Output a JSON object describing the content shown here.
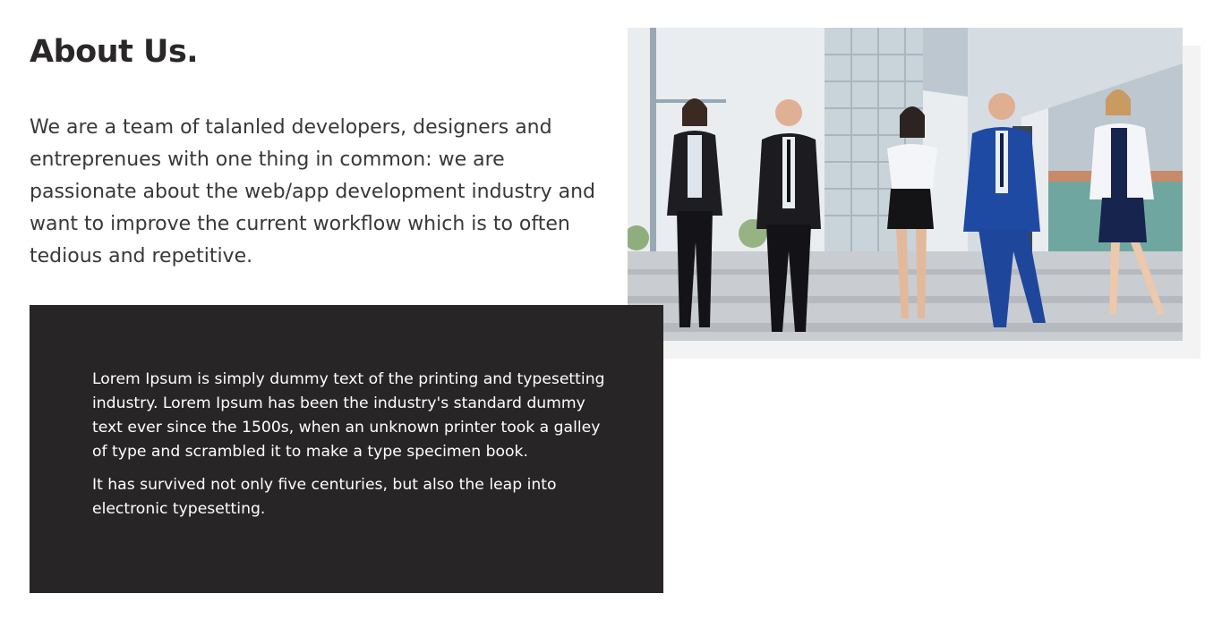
{
  "about": {
    "title": "About Us.",
    "intro": "We are a team of talanled developers, designers and entreprenues with one thing in common: we are passionate about the web/app development industry and want to improve the current workflow which is to often tedious and repetitive."
  },
  "image": {
    "description_icon": "team-photo"
  },
  "dark_panel": {
    "paragraph_1": "Lorem Ipsum is simply dummy text of the printing and typesetting industry. Lorem Ipsum has been the industry's standard dummy text ever since the 1500s, when an unknown printer took a galley of type and scrambled it to make a type specimen book.",
    "paragraph_2": "It has survived not only five centuries, but also the leap into electronic typesetting."
  },
  "colors": {
    "dark_panel_bg": "#272526",
    "photo_shadow": "#f3f3f3",
    "heading": "#2a2727"
  }
}
